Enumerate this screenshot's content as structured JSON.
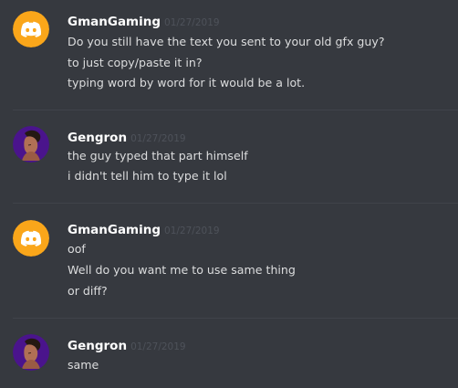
{
  "colors": {
    "background": "#36393f",
    "divider": "#40434a",
    "username": "#ffffff",
    "timestamp": "#4e525a",
    "message_text": "#dcddde",
    "gman_avatar": "#faa61a",
    "gengron_avatar": "#4a148c"
  },
  "messages": [
    {
      "author": "GmanGaming",
      "timestamp": "01/27/2019",
      "avatar_icon": "discord-logo-icon",
      "lines": [
        "Do you still have the text you sent to your old gfx guy?",
        "to just copy/paste it in?",
        "typing word by word for it would be a lot."
      ]
    },
    {
      "author": "Gengron",
      "timestamp": "01/27/2019",
      "avatar_icon": "user-portrait-icon",
      "lines": [
        "the guy typed that part himself",
        "i didn't tell him to type it lol"
      ]
    },
    {
      "author": "GmanGaming",
      "timestamp": "01/27/2019",
      "avatar_icon": "discord-logo-icon",
      "lines": [
        "oof",
        "Well do you want me to use same thing",
        "or diff?"
      ]
    },
    {
      "author": "Gengron",
      "timestamp": "01/27/2019",
      "avatar_icon": "user-portrait-icon",
      "lines": [
        "same"
      ]
    }
  ]
}
